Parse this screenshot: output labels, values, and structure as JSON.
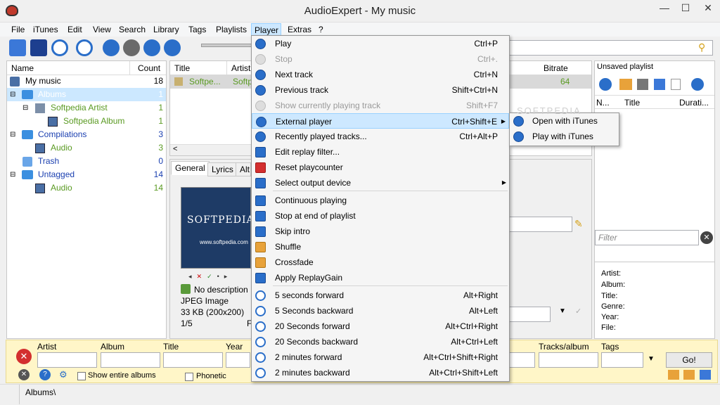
{
  "window": {
    "title": "AudioExpert - My music",
    "minimize": "—",
    "maximize": "☐",
    "close": "✕"
  },
  "menu": [
    "File",
    "iTunes",
    "Edit",
    "View",
    "Search",
    "Library",
    "Tags",
    "Playlists",
    "Player",
    "Extras",
    "?"
  ],
  "tree": {
    "headers": {
      "name": "Name",
      "count": "Count"
    },
    "rows": [
      {
        "label": "My music",
        "count": "18"
      },
      {
        "label": "Albums",
        "count": "1"
      },
      {
        "label": "Softpedia Artist",
        "count": "1"
      },
      {
        "label": "Softpedia Album",
        "count": "1"
      },
      {
        "label": "Compilations",
        "count": "3"
      },
      {
        "label": "Audio",
        "count": "3"
      },
      {
        "label": "Trash",
        "count": "0"
      },
      {
        "label": "Untagged",
        "count": "14"
      },
      {
        "label": "Audio",
        "count": "14"
      }
    ]
  },
  "tracks": {
    "headers": {
      "title": "Title",
      "artist": "Artist",
      "bitrate": "Bitrate"
    },
    "row": {
      "title": "Softpe...",
      "artist": "Softp",
      "bitrate": "64"
    }
  },
  "details": {
    "tabs": [
      "General",
      "Lyrics",
      "Alt"
    ],
    "cover_text": "SOFTPEDIA",
    "cover_url": "www.softpedia.com",
    "no_description": "No description",
    "image_type": "JPEG Image",
    "image_size": "33 KB  (200x200)",
    "page": "1/5",
    "f_label": "F"
  },
  "player_menu": [
    {
      "label": "Play",
      "shortcut": "Ctrl+P",
      "disabled": false
    },
    {
      "label": "Stop",
      "shortcut": "Ctrl+.",
      "disabled": true
    },
    {
      "label": "Next track",
      "shortcut": "Ctrl+N",
      "disabled": false
    },
    {
      "label": "Previous track",
      "shortcut": "Shift+Ctrl+N",
      "disabled": false
    },
    {
      "label": "Show currently playing track",
      "shortcut": "Shift+F7",
      "disabled": true
    },
    {
      "label": "External player",
      "shortcut": "Ctrl+Shift+E",
      "disabled": false
    },
    {
      "label": "Recently played tracks...",
      "shortcut": "Ctrl+Alt+P",
      "disabled": false
    },
    {
      "label": "Edit replay filter...",
      "shortcut": "",
      "disabled": false
    },
    {
      "label": "Reset playcounter",
      "shortcut": "",
      "disabled": false
    },
    {
      "label": "Select output device",
      "shortcut": "",
      "disabled": false
    },
    {
      "label": "Continuous playing",
      "shortcut": "",
      "disabled": false
    },
    {
      "label": "Stop at end of playlist",
      "shortcut": "",
      "disabled": false
    },
    {
      "label": "Skip intro",
      "shortcut": "",
      "disabled": false
    },
    {
      "label": "Shuffle",
      "shortcut": "",
      "disabled": false
    },
    {
      "label": "Crossfade",
      "shortcut": "",
      "disabled": false
    },
    {
      "label": "Apply ReplayGain",
      "shortcut": "",
      "disabled": false
    },
    {
      "label": "5 seconds forward",
      "shortcut": "Alt+Right",
      "disabled": false
    },
    {
      "label": "5 Seconds backward",
      "shortcut": "Alt+Left",
      "disabled": false
    },
    {
      "label": "20 Seconds forward",
      "shortcut": "Alt+Ctrl+Right",
      "disabled": false
    },
    {
      "label": "20 Seconds backward",
      "shortcut": "Alt+Ctrl+Left",
      "disabled": false
    },
    {
      "label": "2 minutes forward",
      "shortcut": "Alt+Ctrl+Shift+Right",
      "disabled": false
    },
    {
      "label": "2 minutes backward",
      "shortcut": "Alt+Ctrl+Shift+Left",
      "disabled": false
    }
  ],
  "submenu": [
    "Open with iTunes",
    "Play with iTunes"
  ],
  "playlist": {
    "title": "Unsaved playlist",
    "headers": {
      "num": "N...",
      "title": "Title",
      "duration": "Durati..."
    },
    "filter_placeholder": "Filter",
    "info": [
      "Artist:",
      "Album:",
      "Title:",
      "Genre:",
      "Year:",
      "File:"
    ]
  },
  "search": {
    "labels": {
      "artist": "Artist",
      "album": "Album",
      "title": "Title",
      "year": "Year",
      "tracks": "Tracks/album",
      "tags": "Tags"
    },
    "show_entire": "Show entire albums",
    "phonetic": "Phonetic",
    "go": "Go!"
  },
  "status": {
    "path": "Albums\\"
  },
  "watermark": "SOFTPEDIA"
}
